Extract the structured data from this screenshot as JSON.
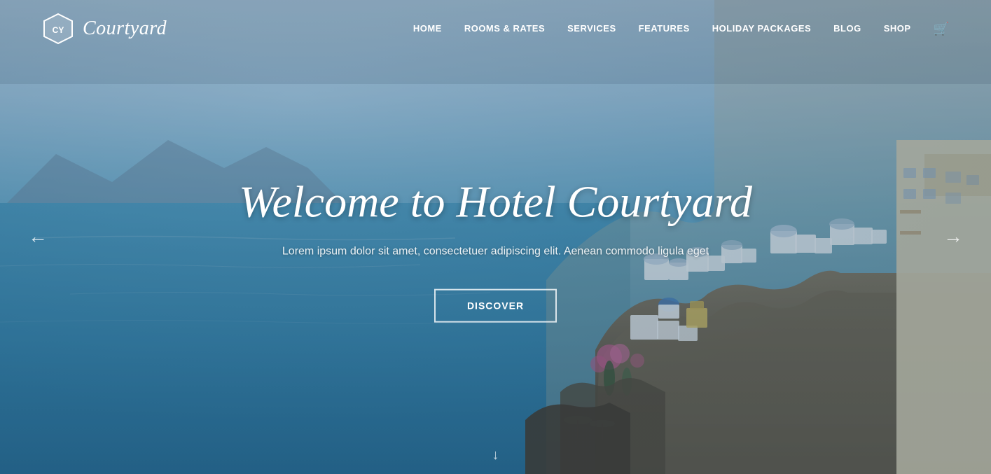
{
  "site": {
    "logo_abbr": "CY",
    "logo_name": "Courtyard"
  },
  "navbar": {
    "links": [
      {
        "label": "HOME",
        "href": "#"
      },
      {
        "label": "ROOMS & RATES",
        "href": "#"
      },
      {
        "label": "SERVICES",
        "href": "#"
      },
      {
        "label": "FEATURES",
        "href": "#"
      },
      {
        "label": "HOLIDAY PACKAGES",
        "href": "#"
      },
      {
        "label": "BLOG",
        "href": "#"
      },
      {
        "label": "SHOP",
        "href": "#"
      }
    ]
  },
  "hero": {
    "title": "Welcome to Hotel Courtyard",
    "subtitle": "Lorem ipsum dolor sit amet, consectetuer adipiscing elit. Aenean commodo ligula eget",
    "cta_label": "Discover",
    "arrow_left": "←",
    "arrow_right": "→",
    "arrow_down": "↓"
  },
  "colors": {
    "accent": "#4a9ac0",
    "white": "#ffffff",
    "nav_bg": "transparent"
  }
}
